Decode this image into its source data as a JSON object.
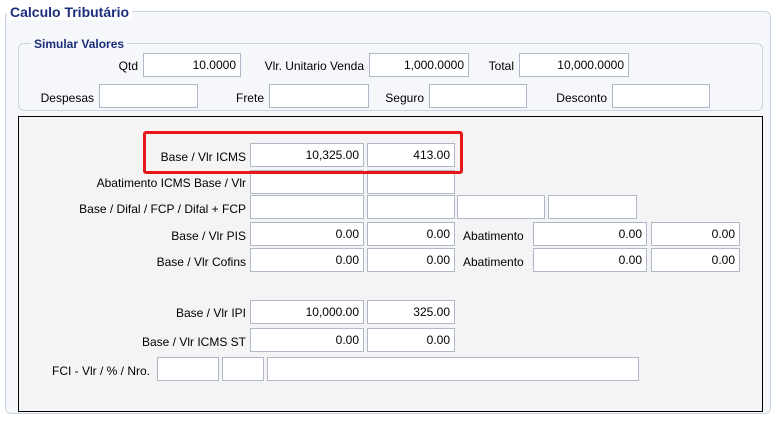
{
  "section_title": "Calculo Tributário",
  "simular": {
    "legend": "Simular Valores",
    "qtd": {
      "label": "Qtd",
      "value": "10.0000"
    },
    "vlr_unitario": {
      "label": "Vlr. Unitario Venda",
      "value": "1,000.0000"
    },
    "total": {
      "label": "Total",
      "value": "10,000.0000"
    },
    "despesas": {
      "label": "Despesas",
      "value": ""
    },
    "frete": {
      "label": "Frete",
      "value": ""
    },
    "seguro": {
      "label": "Seguro",
      "value": ""
    },
    "desconto": {
      "label": "Desconto",
      "value": ""
    }
  },
  "calc": {
    "icms": {
      "label": "Base / Vlr ICMS",
      "base": "10,325.00",
      "vlr": "413.00"
    },
    "abatimento_icms": {
      "label": "Abatimento ICMS Base  / Vlr",
      "base": "",
      "vlr": ""
    },
    "difal": {
      "label": "Base / Difal / FCP / Difal + FCP",
      "base": "",
      "difal": "",
      "fcp": "",
      "difal_fcp": ""
    },
    "pis": {
      "label": "Base / Vlr PIS",
      "base": "0.00",
      "vlr": "0.00",
      "abatimento_label": "Abatimento",
      "abatimento_base": "0.00",
      "abatimento_vlr": "0.00"
    },
    "cofins": {
      "label": "Base / Vlr Cofins",
      "base": "0.00",
      "vlr": "0.00",
      "abatimento_label": "Abatimento",
      "abatimento_base": "0.00",
      "abatimento_vlr": "0.00"
    },
    "ipi": {
      "label": "Base / Vlr IPI",
      "base": "10,000.00",
      "vlr": "325.00"
    },
    "icms_st": {
      "label": "Base / Vlr ICMS ST",
      "base": "0.00",
      "vlr": "0.00"
    },
    "fci": {
      "label": "FCI - Vlr / % / Nro.",
      "vlr": "",
      "pct": "",
      "nro": ""
    }
  },
  "colors": {
    "highlight": "#e8151b",
    "legend": "#1a2e7a"
  }
}
